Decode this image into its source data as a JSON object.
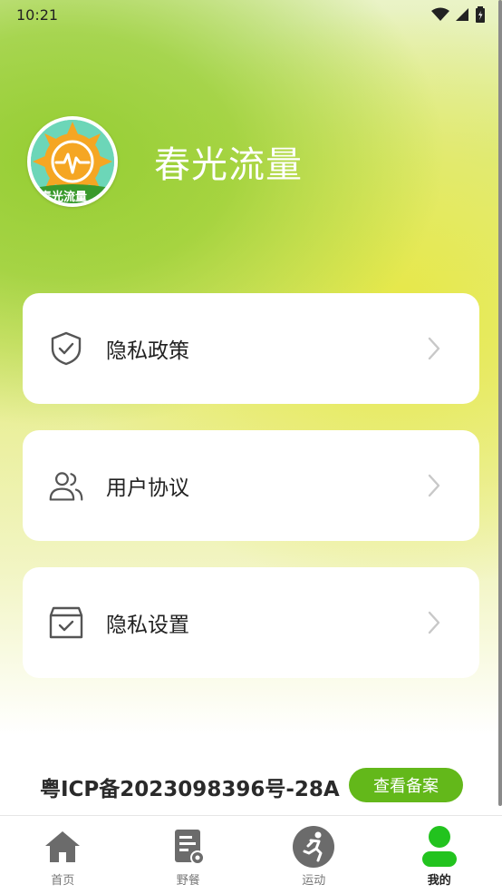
{
  "status_bar": {
    "time": "10:21"
  },
  "profile": {
    "app_name": "春光流量",
    "logo_text": "春光流量"
  },
  "menu": [
    {
      "label": "隐私政策",
      "icon": "shield-check-icon"
    },
    {
      "label": "用户协议",
      "icon": "users-icon"
    },
    {
      "label": "隐私设置",
      "icon": "box-check-icon"
    }
  ],
  "footer": {
    "icp": "粤ICP备2023098396号-28A",
    "view_button": "查看备案"
  },
  "tabs": [
    {
      "label": "首页",
      "icon": "home-icon"
    },
    {
      "label": "野餐",
      "icon": "picnic-icon"
    },
    {
      "label": "运动",
      "icon": "running-icon"
    },
    {
      "label": "我的",
      "icon": "user-icon",
      "active": true
    }
  ],
  "colors": {
    "accent": "#63b81a",
    "tab_active": "#22c31e",
    "tab_inactive": "#6b6b6b"
  }
}
